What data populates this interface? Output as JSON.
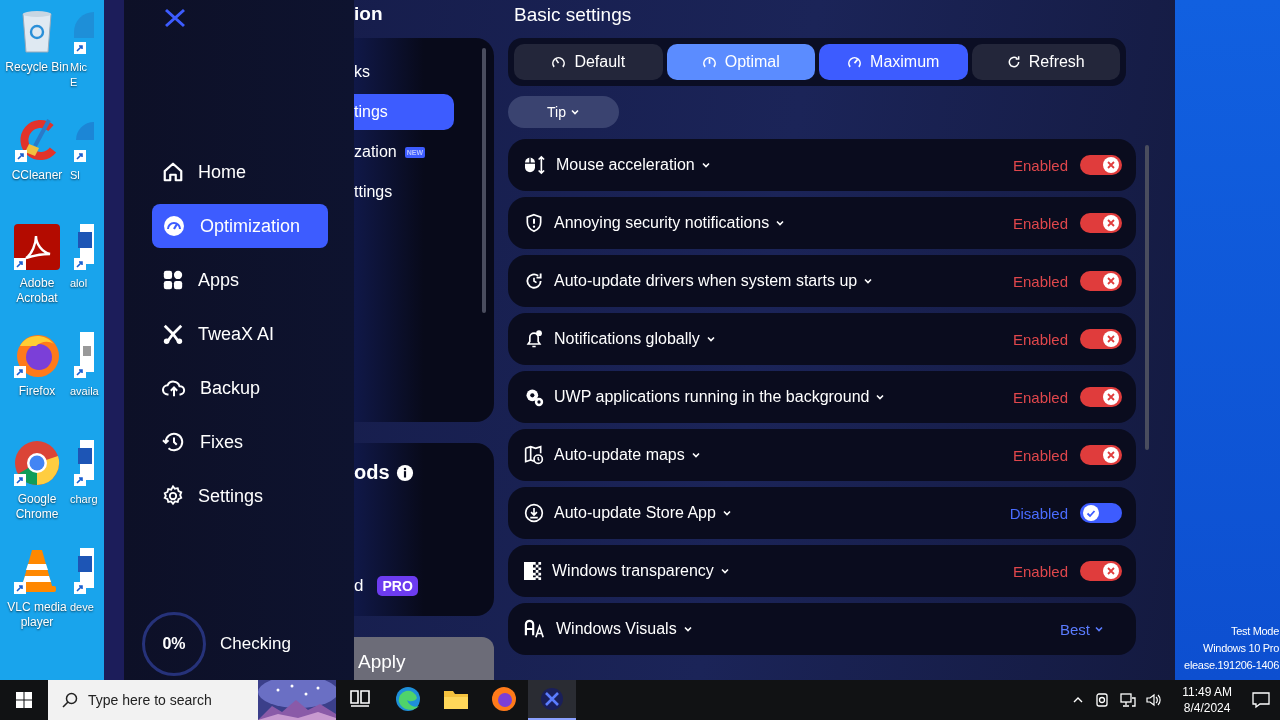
{
  "desktop": {
    "icons": [
      {
        "label": "Recycle Bin"
      },
      {
        "label": "CCleaner"
      },
      {
        "label": "Adobe Acrobat"
      },
      {
        "label": "Firefox"
      },
      {
        "label": "Google Chrome"
      },
      {
        "label": "VLC media player"
      }
    ],
    "icons_column_2": [
      {
        "label": "Mic E"
      },
      {
        "label": "Sl"
      },
      {
        "label": "alol"
      },
      {
        "label": "availa"
      },
      {
        "label": "charg"
      },
      {
        "label": "deve"
      }
    ],
    "watermark_text": [
      "Test Mode",
      "Windows 10 Pro",
      "elease.191206-1406"
    ]
  },
  "sidebar": {
    "items": [
      {
        "label": "Home",
        "selected": false
      },
      {
        "label": "Optimization",
        "selected": true
      },
      {
        "label": "Apps",
        "selected": false
      },
      {
        "label": "TweaX AI",
        "selected": false
      },
      {
        "label": "Backup",
        "selected": false
      },
      {
        "label": "Fixes",
        "selected": false
      },
      {
        "label": "Settings",
        "selected": false
      }
    ],
    "progress": {
      "value": "0%",
      "status": "Checking"
    }
  },
  "middle_panel": {
    "title": "ion",
    "items": [
      {
        "label": "ks",
        "selected": false
      },
      {
        "label": "tings",
        "selected": true
      },
      {
        "label": "zation",
        "badge": "NEW",
        "selected": false
      },
      {
        "label": "ttings",
        "selected": false
      }
    ],
    "methods": {
      "title": "ods",
      "option": "d",
      "badge": "PRO"
    },
    "apply_button": "Apply"
  },
  "settings": {
    "title": "Basic settings",
    "modes": [
      {
        "label": "Default",
        "selected": false,
        "highlighted": false
      },
      {
        "label": "Optimal",
        "selected": false,
        "highlighted": true
      },
      {
        "label": "Maximum",
        "selected": true,
        "highlighted": false
      },
      {
        "label": "Refresh",
        "selected": false,
        "highlighted": false
      }
    ],
    "tip_button": "Tip",
    "rows": [
      {
        "label": "Mouse acceleration",
        "kind": "toggle",
        "status": "Enabled",
        "enabled": true
      },
      {
        "label": "Annoying security notifications",
        "kind": "toggle",
        "status": "Enabled",
        "enabled": true
      },
      {
        "label": "Auto-update drivers when system starts up",
        "kind": "toggle",
        "status": "Enabled",
        "enabled": true
      },
      {
        "label": "Notifications globally",
        "kind": "toggle",
        "status": "Enabled",
        "enabled": true
      },
      {
        "label": "UWP applications running in the background",
        "kind": "toggle",
        "status": "Enabled",
        "enabled": true
      },
      {
        "label": "Auto-update maps",
        "kind": "toggle",
        "status": "Enabled",
        "enabled": true
      },
      {
        "label": "Auto-update Store App",
        "kind": "toggle",
        "status": "Disabled",
        "enabled": false
      },
      {
        "label": "Windows transparency",
        "kind": "toggle",
        "status": "Enabled",
        "enabled": true
      },
      {
        "label": "Windows Visuals",
        "kind": "dropdown",
        "status": "Best"
      }
    ]
  },
  "taskbar": {
    "search": {
      "placeholder": "Type here to search"
    },
    "apps": [
      {
        "active": false
      },
      {
        "active": false
      },
      {
        "active": false
      },
      {
        "active": false
      },
      {
        "active": true
      }
    ],
    "time": "11:49 AM",
    "date": "8/4/2024"
  }
}
